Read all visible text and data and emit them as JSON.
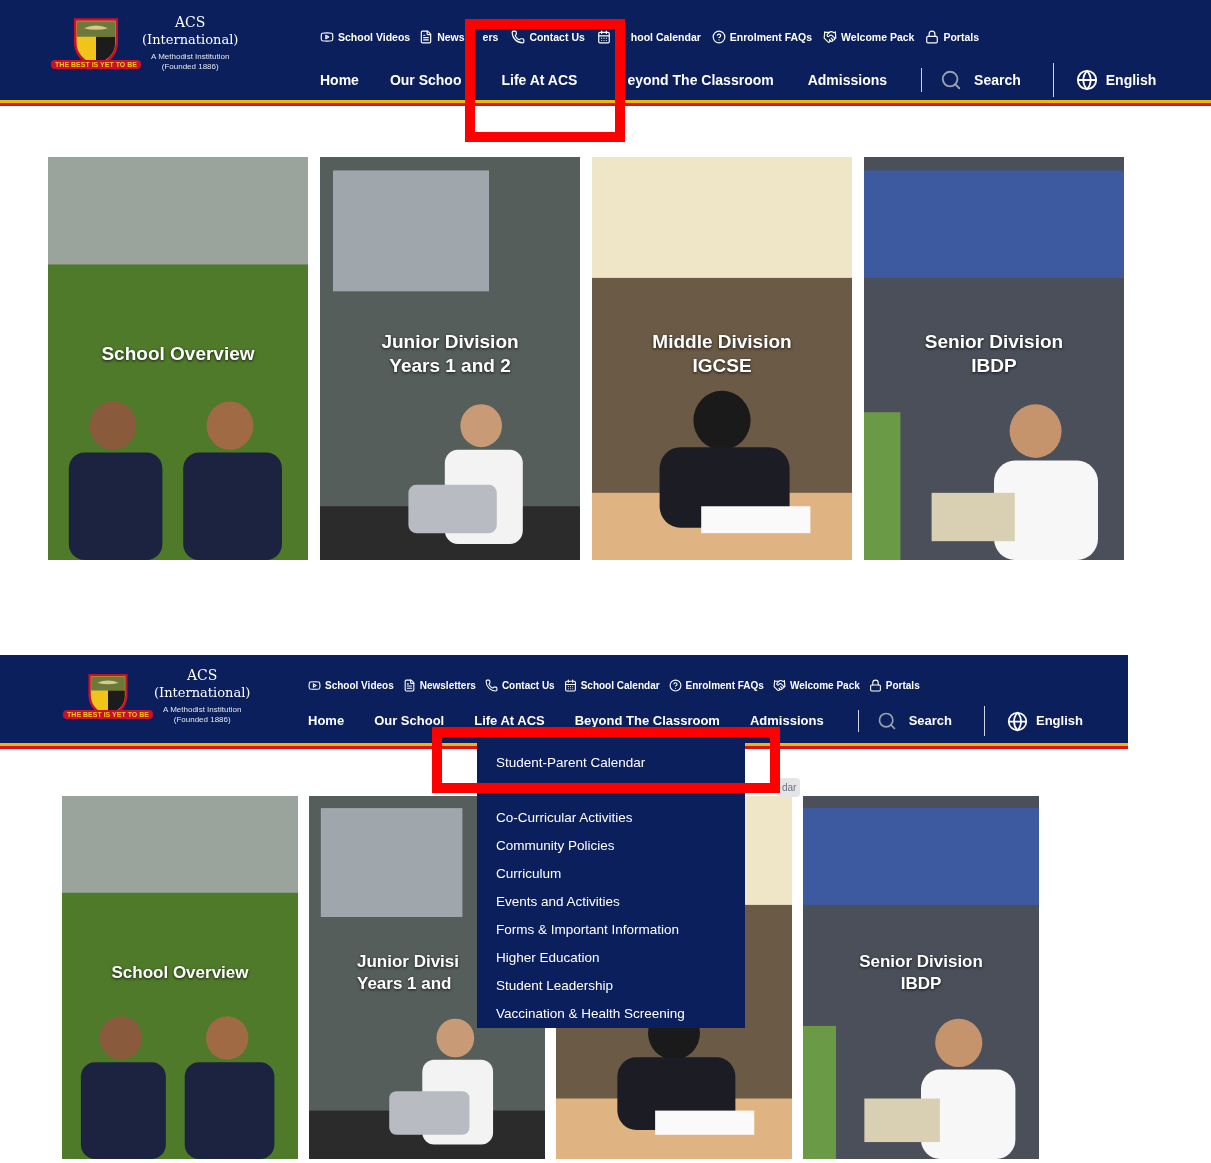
{
  "screenshots": [
    {
      "header": {
        "logo": {
          "name": "ACS",
          "subname": "(International)",
          "tagline": "A Methodist Institution",
          "founded": "(Founded 1886)",
          "motto": "THE BEST IS YET TO BE"
        },
        "quick_links": [
          {
            "kind": "video",
            "label": "School Videos"
          },
          {
            "kind": "document",
            "label": "News"
          },
          {
            "kind": "text",
            "label": "ers"
          },
          {
            "kind": "phone",
            "label": "Contact Us"
          },
          {
            "kind": "calendar"
          },
          {
            "kind": "text",
            "label": "hool Calendar"
          },
          {
            "kind": "help",
            "label": "Enrolment FAQs"
          },
          {
            "kind": "welcome",
            "label": "Welcome Pack"
          },
          {
            "kind": "lock",
            "label": "Portals"
          }
        ],
        "nav": [
          "Home",
          "Our Schoo",
          "Life At ACS",
          "eyond The Classroom",
          "Admissions"
        ],
        "search": "Search",
        "language": "English"
      },
      "tiles": [
        {
          "kind": "picture",
          "labels": [
            "School Overview"
          ]
        },
        {
          "kind": "picture",
          "labels": [
            "Junior Division",
            "Years 1 and 2"
          ]
        },
        {
          "kind": "picture",
          "labels": [
            "Middle Division",
            "IGCSE"
          ]
        },
        {
          "kind": "picture",
          "labels": [
            "Senior Division",
            "IBDP"
          ]
        }
      ]
    },
    {
      "header": {
        "logo": {
          "name": "ACS",
          "subname": "(International)",
          "tagline": "A Methodist Institution",
          "founded": "(Founded 1886)",
          "motto": "THE BEST IS YET TO BE"
        },
        "quick_links": [
          {
            "kind": "video",
            "label": "School Videos"
          },
          {
            "kind": "document",
            "label": "Newsletters"
          },
          {
            "kind": "phone",
            "label": "Contact Us"
          },
          {
            "kind": "calendar",
            "label": "School Calendar"
          },
          {
            "kind": "help",
            "label": "Enrolment FAQs"
          },
          {
            "kind": "welcome",
            "label": "Welcome Pack"
          },
          {
            "kind": "lock",
            "label": "Portals"
          }
        ],
        "nav": [
          "Home",
          "Our School",
          "Life At ACS",
          "Beyond The Classroom",
          "Admissions"
        ],
        "search": "Search",
        "language": "English"
      },
      "dropdown": [
        "Student-Parent Calendar",
        "Co-Curricular Activities",
        "Community Policies",
        "Curriculum",
        "Events and Activities",
        "Forms & Important Information",
        "Higher Education",
        "Student Leadership",
        "Vaccination & Health Screening"
      ],
      "tooltip": "dar",
      "tiles": [
        {
          "kind": "picture",
          "labels": [
            "School Overview"
          ]
        },
        {
          "kind": "picture",
          "labels": [
            "Junior Divisi",
            "Years 1 and"
          ]
        },
        {
          "kind": "picture"
        },
        {
          "kind": "picture",
          "labels": [
            "Senior Division",
            "IBDP"
          ]
        }
      ]
    }
  ]
}
